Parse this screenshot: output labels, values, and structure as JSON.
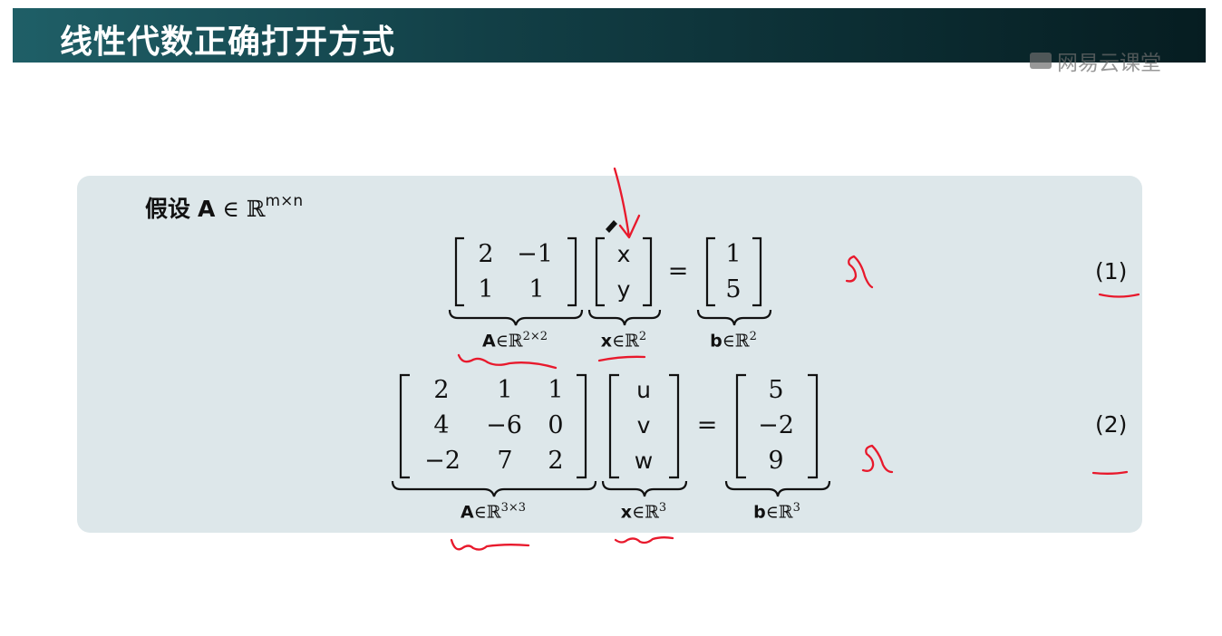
{
  "slide": {
    "title": "线性代数正确打开方式",
    "watermark": "网易云课堂",
    "assume_label": "假设",
    "assume_symbol": "A",
    "assume_relation": "∈ ℝ",
    "assume_exponent": "m×n"
  },
  "equation1": {
    "A": [
      [
        "2",
        "−1"
      ],
      [
        "1",
        "1"
      ]
    ],
    "x": [
      "x",
      "y"
    ],
    "b": [
      "1",
      "5"
    ],
    "equals": "=",
    "A_label": {
      "sym": "A",
      "rel": "∈ℝ",
      "exp": "2×2"
    },
    "x_label": {
      "sym": "x",
      "rel": "∈ℝ",
      "exp": "2"
    },
    "b_label": {
      "sym": "b",
      "rel": "∈ℝ",
      "exp": "2"
    },
    "number": "(1)"
  },
  "equation2": {
    "A": [
      [
        "2",
        "1",
        "1"
      ],
      [
        "4",
        "−6",
        "0"
      ],
      [
        "−2",
        "7",
        "2"
      ]
    ],
    "x": [
      "u",
      "v",
      "w"
    ],
    "b": [
      "5",
      "−2",
      "9"
    ],
    "equals": "=",
    "A_label": {
      "sym": "A",
      "rel": "∈ℝ",
      "exp": "3×3"
    },
    "x_label": {
      "sym": "x",
      "rel": "∈ℝ",
      "exp": "3"
    },
    "b_label": {
      "sym": "b",
      "rel": "∈ℝ",
      "exp": "3"
    },
    "number": "(2)"
  },
  "annotations": {
    "ink_color": "#e8192c",
    "marks": [
      "arrow-pointing-to-x",
      "cross-mark-eq1",
      "cross-mark-eq2",
      "underline-eq1-number",
      "underline-eq2-number",
      "squiggle-under-A-label-eq1",
      "underline-x-label-eq1",
      "squiggle-under-A-label-eq2",
      "squiggle-under-x-label-eq2"
    ]
  }
}
